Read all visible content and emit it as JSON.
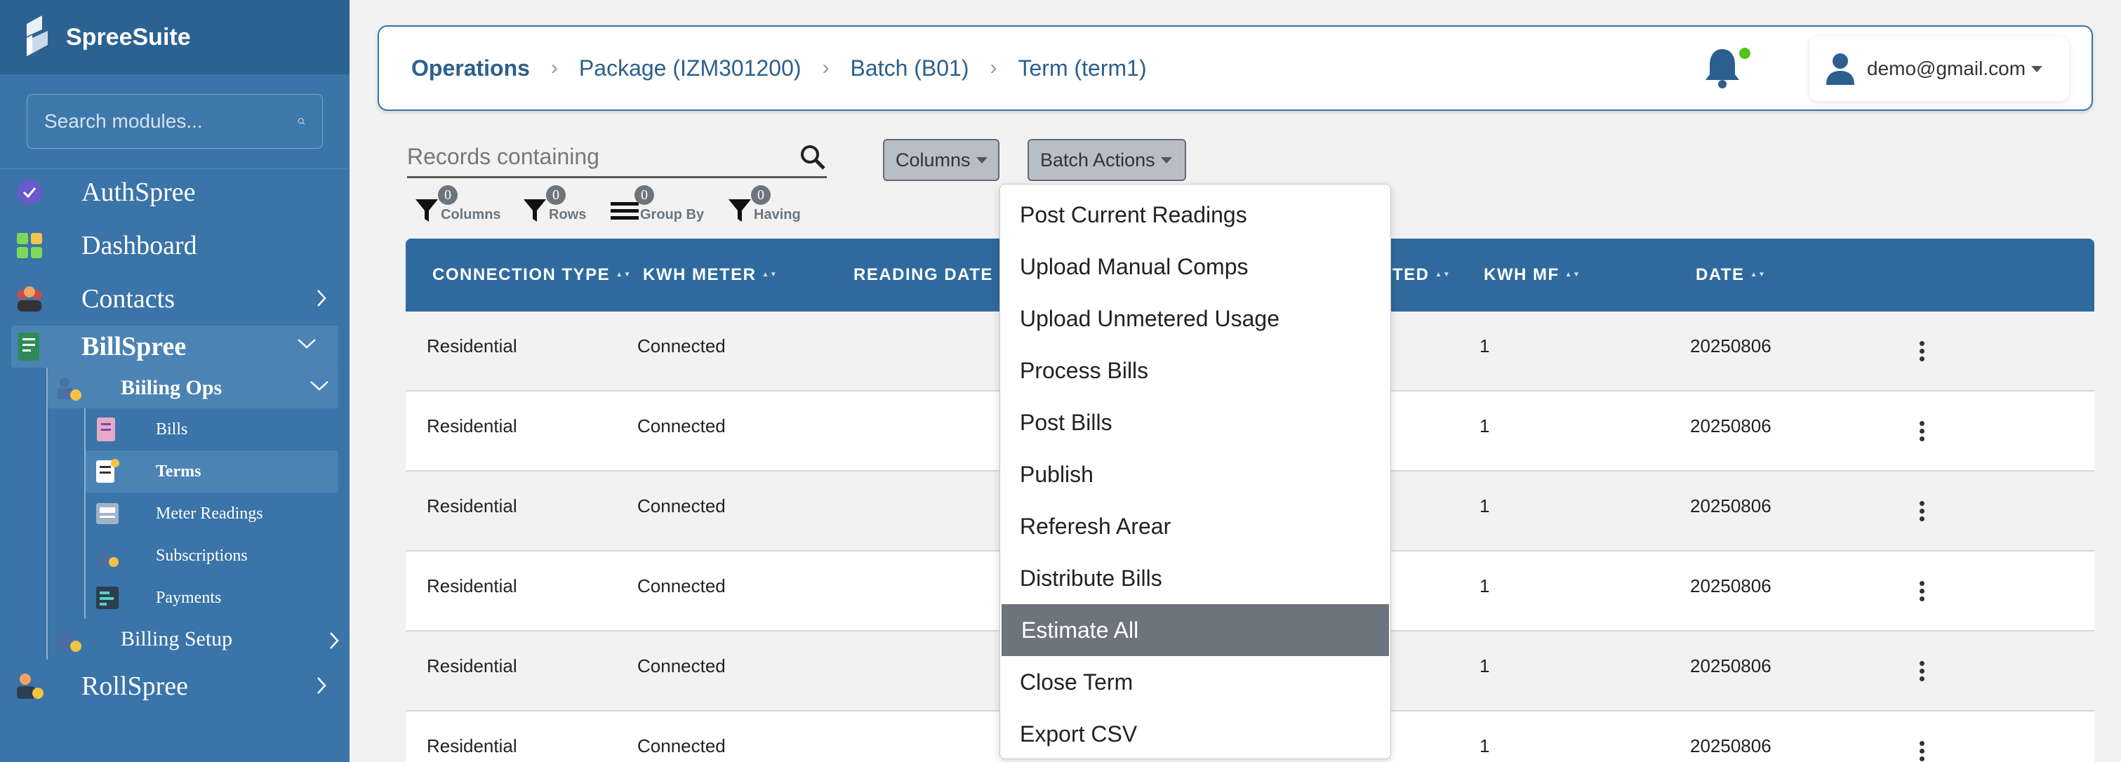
{
  "app": {
    "name": "SpreeSuite"
  },
  "search": {
    "placeholder": "Search modules..."
  },
  "nav": {
    "authspree": "AuthSpree",
    "dashboard": "Dashboard",
    "contacts": "Contacts",
    "billspree": "BillSpree",
    "billing_ops": "Biiling Ops",
    "bills": "Bills",
    "terms": "Terms",
    "meter_readings": "Meter Readings",
    "subscriptions": "Subscriptions",
    "payments": "Payments",
    "billing_setup": "Billing Setup",
    "rollspree": "RollSpree"
  },
  "breadcrumb": [
    "Operations",
    "Package (IZM301200)",
    "Batch (B01)",
    "Term (term1)"
  ],
  "user": {
    "email": "demo@gmail.com"
  },
  "toolbar": {
    "records_placeholder": "Records containing",
    "columns_label": "Columns",
    "batch_actions_label": "Batch Actions",
    "filters": [
      {
        "label": "Columns",
        "count": "0"
      },
      {
        "label": "Rows",
        "count": "0"
      },
      {
        "label": "Group By",
        "count": "0"
      },
      {
        "label": "Having",
        "count": "0"
      }
    ]
  },
  "table": {
    "headers": [
      "CONNECTION TYPE",
      "KWH METER",
      "READING DATE",
      "TED",
      "KWH MF",
      "DATE"
    ],
    "rows": [
      {
        "connection_type": "Residential",
        "kwh_meter": "Connected",
        "kwh_mf": "1",
        "date": "20250806"
      },
      {
        "connection_type": "Residential",
        "kwh_meter": "Connected",
        "kwh_mf": "1",
        "date": "20250806"
      },
      {
        "connection_type": "Residential",
        "kwh_meter": "Connected",
        "kwh_mf": "1",
        "date": "20250806"
      },
      {
        "connection_type": "Residential",
        "kwh_meter": "Connected",
        "kwh_mf": "1",
        "date": "20250806"
      },
      {
        "connection_type": "Residential",
        "kwh_meter": "Connected",
        "kwh_mf": "1",
        "date": "20250806"
      },
      {
        "connection_type": "Residential",
        "kwh_meter": "Connected",
        "kwh_mf": "1",
        "date": "20250806"
      }
    ]
  },
  "batch_menu": {
    "items": [
      "Post Current Readings",
      "Upload Manual Comps",
      "Upload Unmetered Usage",
      "Process Bills",
      "Post Bills",
      "Publish",
      "Referesh Arear",
      "Distribute Bills",
      "Estimate All",
      "Close Term",
      "Export CSV"
    ],
    "highlighted": "Estimate All"
  },
  "colors": {
    "sidebar": "#3a74a8",
    "header_accent": "#2c5f8e",
    "table_header": "#2f6a9e",
    "menu_highlight": "#6c757d",
    "notification_dot": "#52c41a"
  },
  "icons": [
    "spreesuite-logo-icon",
    "search-icon",
    "authspree-icon",
    "dashboard-icon",
    "contacts-icon",
    "billspree-icon",
    "billing-ops-icon",
    "bills-icon",
    "terms-icon",
    "meter-readings-icon",
    "subscriptions-icon",
    "payments-icon",
    "billing-setup-icon",
    "rollspree-icon",
    "bell-icon",
    "user-icon",
    "filter-icon",
    "group-by-icon",
    "kebab-icon"
  ]
}
